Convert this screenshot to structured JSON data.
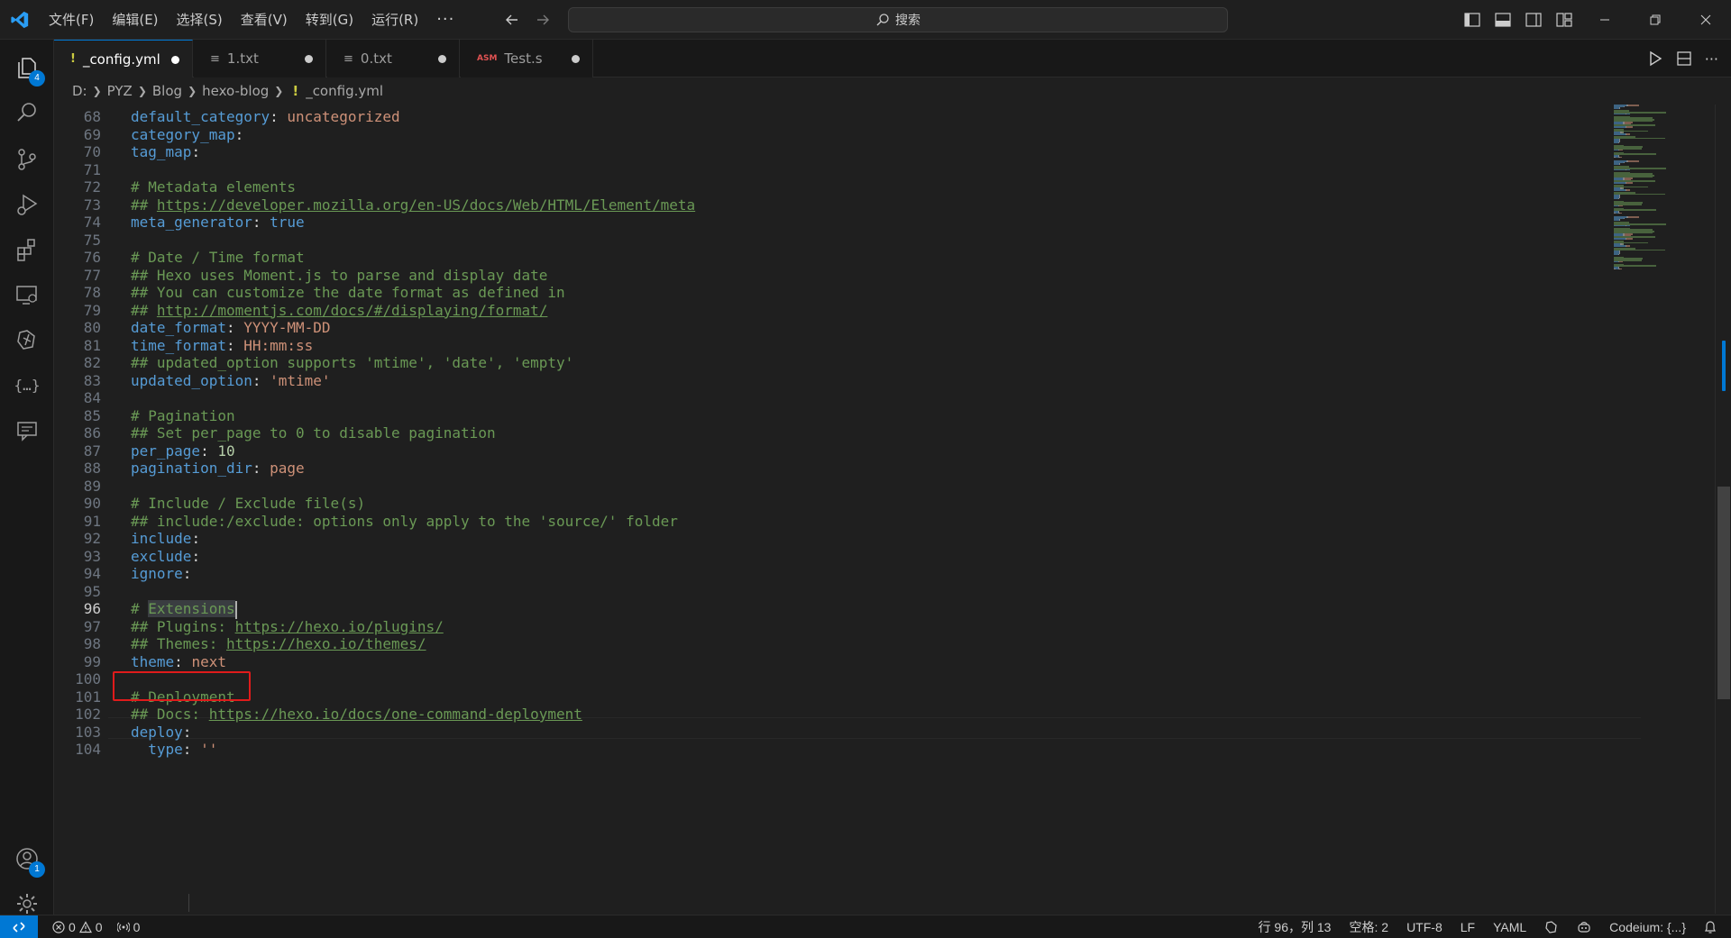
{
  "menu": {
    "items": [
      "文件(F)",
      "编辑(E)",
      "选择(S)",
      "查看(V)",
      "转到(G)",
      "运行(R)"
    ],
    "more": "···"
  },
  "search": {
    "label": "搜索"
  },
  "tabs": [
    {
      "icon": "!",
      "label": "_config.yml",
      "active": true
    },
    {
      "icon": "≡",
      "label": "1.txt",
      "active": false
    },
    {
      "icon": "≡",
      "label": "0.txt",
      "active": false
    },
    {
      "icon": "ASM",
      "label": "Test.s",
      "active": false
    }
  ],
  "breadcrumb": {
    "drive": "D:",
    "parts": [
      "PYZ",
      "Blog",
      "hexo-blog"
    ],
    "file_icon": "!",
    "file": "_config.yml"
  },
  "activity_badges": {
    "explorer": "4",
    "accounts": "1"
  },
  "editor": {
    "lines": [
      {
        "n": "68",
        "tokens": [
          [
            "key",
            "default_category"
          ],
          [
            "plain",
            ": "
          ],
          [
            "str",
            "uncategorized"
          ]
        ]
      },
      {
        "n": "69",
        "tokens": [
          [
            "key",
            "category_map"
          ],
          [
            "plain",
            ":"
          ]
        ]
      },
      {
        "n": "70",
        "tokens": [
          [
            "key",
            "tag_map"
          ],
          [
            "plain",
            ":"
          ]
        ]
      },
      {
        "n": "71",
        "tokens": []
      },
      {
        "n": "72",
        "tokens": [
          [
            "cm",
            "# Metadata elements"
          ]
        ]
      },
      {
        "n": "73",
        "tokens": [
          [
            "cm",
            "## "
          ],
          [
            "link",
            "https://developer.mozilla.org/en-US/docs/Web/HTML/Element/meta"
          ]
        ]
      },
      {
        "n": "74",
        "tokens": [
          [
            "key",
            "meta_generator"
          ],
          [
            "plain",
            ": "
          ],
          [
            "key",
            "true"
          ]
        ]
      },
      {
        "n": "75",
        "tokens": []
      },
      {
        "n": "76",
        "tokens": [
          [
            "cm",
            "# Date / Time format"
          ]
        ]
      },
      {
        "n": "77",
        "tokens": [
          [
            "cm",
            "## Hexo uses Moment.js to parse and display date"
          ]
        ]
      },
      {
        "n": "78",
        "tokens": [
          [
            "cm",
            "## You can customize the date format as defined in"
          ]
        ]
      },
      {
        "n": "79",
        "tokens": [
          [
            "cm",
            "## "
          ],
          [
            "link",
            "http://momentjs.com/docs/#/displaying/format/"
          ]
        ]
      },
      {
        "n": "80",
        "tokens": [
          [
            "key",
            "date_format"
          ],
          [
            "plain",
            ": "
          ],
          [
            "str",
            "YYYY-MM-DD"
          ]
        ]
      },
      {
        "n": "81",
        "tokens": [
          [
            "key",
            "time_format"
          ],
          [
            "plain",
            ": "
          ],
          [
            "str",
            "HH:mm:ss"
          ]
        ]
      },
      {
        "n": "82",
        "tokens": [
          [
            "cm",
            "## updated_option supports 'mtime', 'date', 'empty'"
          ]
        ]
      },
      {
        "n": "83",
        "tokens": [
          [
            "key",
            "updated_option"
          ],
          [
            "plain",
            ": "
          ],
          [
            "str",
            "'mtime'"
          ]
        ]
      },
      {
        "n": "84",
        "tokens": []
      },
      {
        "n": "85",
        "tokens": [
          [
            "cm",
            "# Pagination"
          ]
        ]
      },
      {
        "n": "86",
        "tokens": [
          [
            "cm",
            "## Set per_page to 0 to disable pagination"
          ]
        ]
      },
      {
        "n": "87",
        "tokens": [
          [
            "key",
            "per_page"
          ],
          [
            "plain",
            ": "
          ],
          [
            "num",
            "10"
          ]
        ]
      },
      {
        "n": "88",
        "tokens": [
          [
            "key",
            "pagination_dir"
          ],
          [
            "plain",
            ": "
          ],
          [
            "str",
            "page"
          ]
        ]
      },
      {
        "n": "89",
        "tokens": []
      },
      {
        "n": "90",
        "tokens": [
          [
            "cm",
            "# Include / Exclude file(s)"
          ]
        ]
      },
      {
        "n": "91",
        "tokens": [
          [
            "cm",
            "## include:/exclude: options only apply to the 'source/' folder"
          ]
        ]
      },
      {
        "n": "92",
        "tokens": [
          [
            "key",
            "include"
          ],
          [
            "plain",
            ":"
          ]
        ]
      },
      {
        "n": "93",
        "tokens": [
          [
            "key",
            "exclude"
          ],
          [
            "plain",
            ":"
          ]
        ]
      },
      {
        "n": "94",
        "tokens": [
          [
            "key",
            "ignore"
          ],
          [
            "plain",
            ":"
          ]
        ]
      },
      {
        "n": "95",
        "tokens": []
      },
      {
        "n": "96",
        "tokens": [
          [
            "cm",
            "# "
          ],
          [
            "hl",
            "Extensions"
          ],
          [
            "cursor",
            ""
          ]
        ],
        "current": true
      },
      {
        "n": "97",
        "tokens": [
          [
            "cm",
            "## Plugins: "
          ],
          [
            "link",
            "https://hexo.io/plugins/"
          ]
        ]
      },
      {
        "n": "98",
        "tokens": [
          [
            "cm",
            "## Themes: "
          ],
          [
            "link",
            "https://hexo.io/themes/"
          ]
        ]
      },
      {
        "n": "99",
        "tokens": [
          [
            "key",
            "theme"
          ],
          [
            "plain",
            ": "
          ],
          [
            "str",
            "next"
          ]
        ]
      },
      {
        "n": "100",
        "tokens": []
      },
      {
        "n": "101",
        "tokens": [
          [
            "cm",
            "# Deployment"
          ]
        ]
      },
      {
        "n": "102",
        "tokens": [
          [
            "cm",
            "## Docs: "
          ],
          [
            "link",
            "https://hexo.io/docs/one-command-deployment"
          ]
        ]
      },
      {
        "n": "103",
        "tokens": [
          [
            "key",
            "deploy"
          ],
          [
            "plain",
            ":"
          ]
        ]
      },
      {
        "n": "104",
        "tokens": [
          [
            "plain",
            "  "
          ],
          [
            "key",
            "type"
          ],
          [
            "plain",
            ": "
          ],
          [
            "str",
            "''"
          ]
        ]
      }
    ]
  },
  "status": {
    "errors": "0",
    "warnings": "0",
    "ports": "0",
    "position": "行 96，列 13",
    "spaces": "空格: 2",
    "encoding": "UTF-8",
    "eol": "LF",
    "language": "YAML",
    "codeium": "Codeium: {...}"
  },
  "colors": {
    "accent": "#0078d4",
    "highlight_box": "#e01b1b"
  }
}
